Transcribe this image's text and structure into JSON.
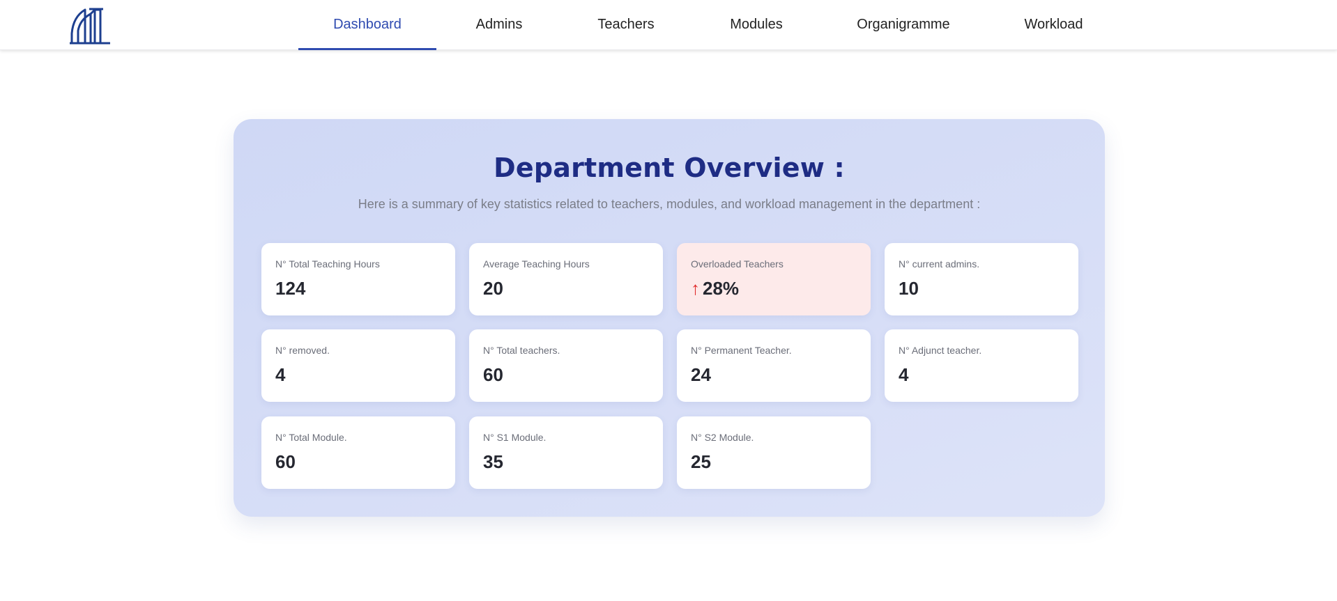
{
  "nav": {
    "logo_icon": "department-logo-icon",
    "items": [
      {
        "label": "Dashboard",
        "active": true
      },
      {
        "label": "Admins",
        "active": false
      },
      {
        "label": "Teachers",
        "active": false
      },
      {
        "label": "Modules",
        "active": false
      },
      {
        "label": "Organigramme",
        "active": false
      },
      {
        "label": "Workload",
        "active": false
      }
    ],
    "active_color": "#2f4bb0"
  },
  "overview": {
    "title": "Department Overview :",
    "subtitle": "Here is a summary of key statistics related to teachers, modules, and workload management in the department :",
    "stats": [
      {
        "label": "N° Total Teaching Hours",
        "value": "124"
      },
      {
        "label": "Average Teaching Hours",
        "value": "20"
      },
      {
        "label": "Overloaded Teachers",
        "value": "28%",
        "trend_icon": "arrow-up-icon",
        "trend_symbol": "↑",
        "highlight_color": "#fdeaea"
      },
      {
        "label": "N° current admins.",
        "value": "10"
      },
      {
        "label": "N° removed.",
        "value": "4"
      },
      {
        "label": "N° Total teachers.",
        "value": "60"
      },
      {
        "label": "N° Permanent Teacher.",
        "value": "24"
      },
      {
        "label": "N° Adjunct teacher.",
        "value": "4"
      },
      {
        "label": "N° Total Module.",
        "value": "60"
      },
      {
        "label": "N° S1 Module.",
        "value": "35"
      },
      {
        "label": "N° S2 Module.",
        "value": "25"
      }
    ]
  }
}
